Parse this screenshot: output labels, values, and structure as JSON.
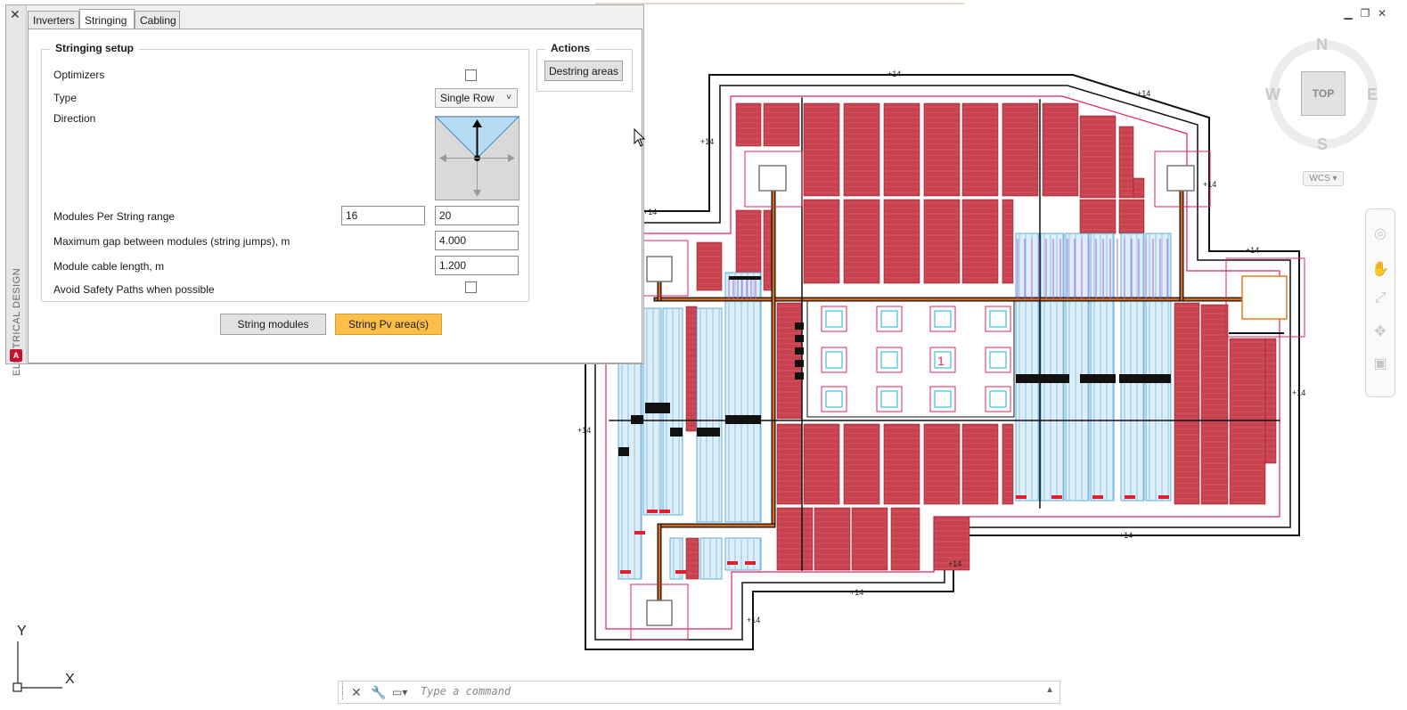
{
  "window_controls": [
    "minimize",
    "restore",
    "close"
  ],
  "palette": {
    "vertical_title": "ELECTRICAL DESIGN",
    "close_glyph": "✕",
    "tabs": [
      {
        "label": "Inverters",
        "active": false
      },
      {
        "label": "Stringing",
        "active": true
      },
      {
        "label": "Cabling",
        "active": false
      }
    ],
    "setup": {
      "title": "Stringing setup",
      "optimizers_label": "Optimizers",
      "optimizers_checked": false,
      "type_label": "Type",
      "type_value": "Single Row",
      "direction_label": "Direction",
      "modules_range_label": "Modules Per String range",
      "modules_min": "16",
      "modules_max": "20",
      "max_gap_label": "Maximum gap between modules (string jumps), m",
      "max_gap_value": "4.000",
      "cable_length_label": "Module cable length, m",
      "cable_length_value": "1.200",
      "avoid_paths_label": "Avoid Safety Paths when possible",
      "avoid_paths_checked": false
    },
    "actions": {
      "title": "Actions",
      "destring_label": "Destring areas"
    },
    "buttons": {
      "string_modules": "String modules",
      "string_pv_areas": "String Pv area(s)"
    },
    "accent_color": "#fbbf47"
  },
  "viewcube": {
    "north": "N",
    "south": "S",
    "east": "E",
    "west": "W",
    "face": "TOP",
    "ucs": "WCS"
  },
  "command_line": {
    "placeholder": "Type a command"
  },
  "ucs_icon": {
    "x_label": "X",
    "y_label": "Y"
  },
  "drawing": {
    "dimension_marks": [
      "+14",
      "+14",
      "+14",
      "+14",
      "+14",
      "+14",
      "+14",
      "+14",
      "+14",
      "+14",
      "+14",
      "+14"
    ],
    "center_label": "1",
    "colors": {
      "module_red": "#c8424f",
      "module_blue": "#3a9bd6",
      "boundary_pink": "#e0245e",
      "cable_orange": "#d46a1c",
      "string_purple": "#b266e0",
      "inverter_black": "#111111"
    }
  }
}
